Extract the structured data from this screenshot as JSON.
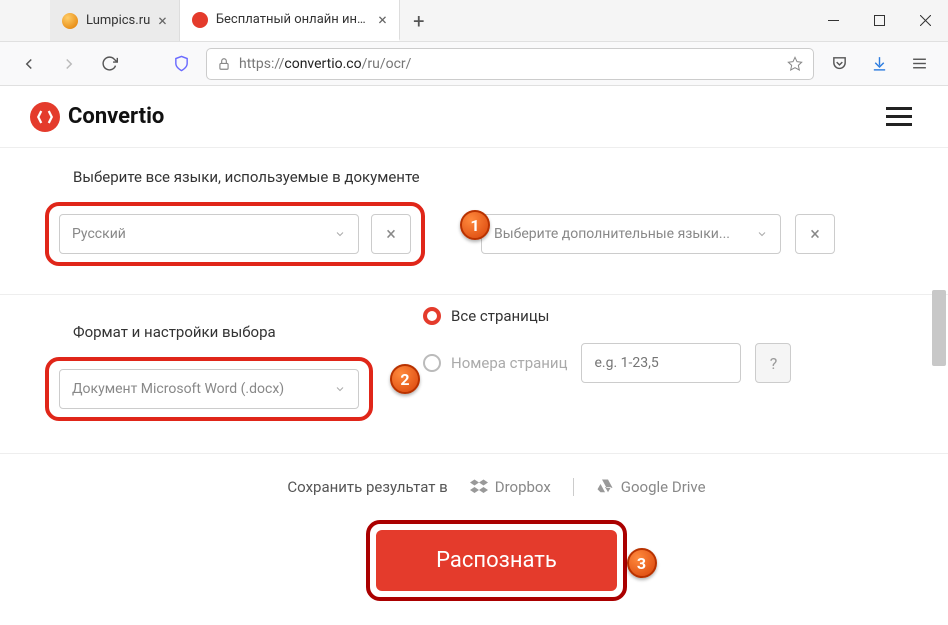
{
  "browser": {
    "tabs": [
      {
        "title": "Lumpics.ru",
        "icon_color": "#f5a623"
      },
      {
        "title": "Бесплатный онлайн инструме",
        "icon_color": "#e43b2c"
      }
    ],
    "url_prefix": "https://",
    "url_host": "convertio.co",
    "url_path": "/ru/ocr/"
  },
  "brand": "Convertio",
  "lang_section": {
    "label": "Выберите все языки, используемые в документе",
    "primary": "Русский",
    "additional_placeholder": "Выберите дополнительные языки..."
  },
  "format_section": {
    "label": "Формат и настройки выбора",
    "value": "Документ Microsoft Word (.docx)",
    "radio_all": "Все страницы",
    "radio_pages": "Номера страниц",
    "pages_placeholder": "e.g. 1-23,5"
  },
  "save": {
    "label": "Сохранить результат в",
    "dropbox": "Dropbox",
    "gdrive": "Google Drive"
  },
  "submit": "Распознать",
  "badges": {
    "b1": "1",
    "b2": "2",
    "b3": "3"
  }
}
